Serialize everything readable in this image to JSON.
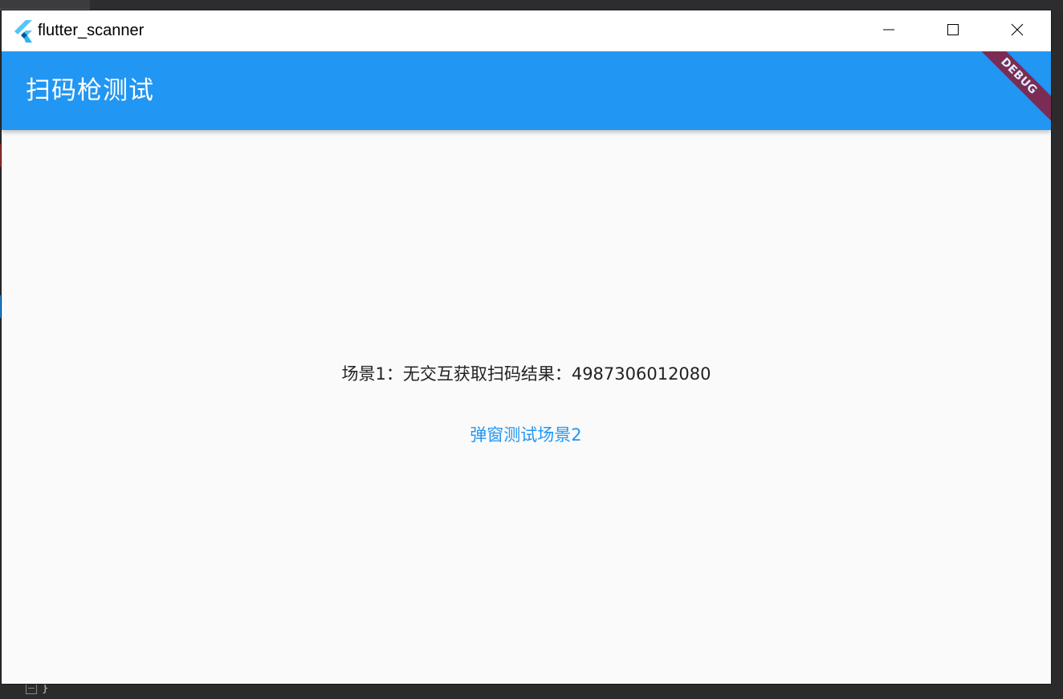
{
  "window": {
    "title": "flutter_scanner",
    "icon": "flutter-logo-icon",
    "controls": {
      "minimize": "minimize-icon",
      "maximize": "maximize-icon",
      "close": "close-icon"
    }
  },
  "appbar": {
    "title": "扫码枪测试",
    "color": "#2196f3"
  },
  "debug_banner": {
    "label": "DEBUG",
    "color": "#8b1a3a"
  },
  "main": {
    "scene1_text": "场景1：无交互获取扫码结果：4987306012080",
    "scene2_button": "弹窗测试场景2"
  },
  "background_ide": {
    "bottom_code": "}"
  }
}
